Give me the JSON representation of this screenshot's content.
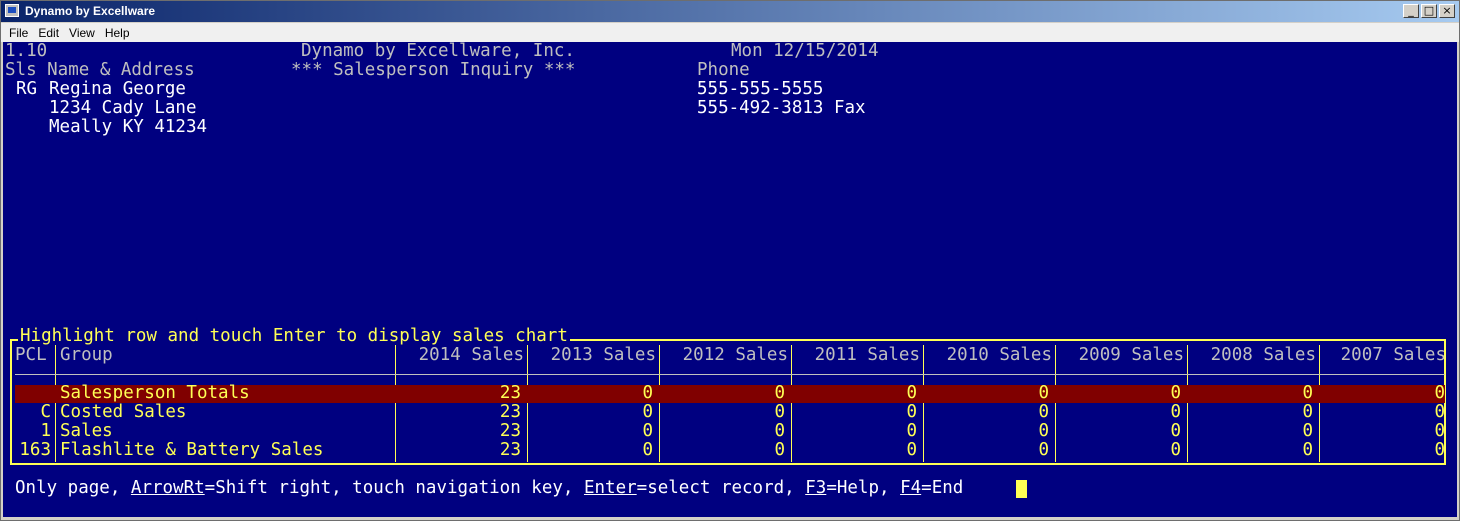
{
  "window": {
    "title": "Dynamo by Excellware",
    "btn_min": "_",
    "btn_max": "□",
    "btn_close": "×"
  },
  "menu": [
    "File",
    "Edit",
    "View",
    "Help"
  ],
  "header": {
    "version": "1.10",
    "company": "Dynamo by Excellware, Inc.",
    "date": "Mon 12/15/2014",
    "col_left": "Sls Name & Address",
    "screen_title": "*** Salesperson Inquiry ***",
    "col_phone": "Phone"
  },
  "salesperson": {
    "code": "RG",
    "name": "Regina George",
    "address1": "1234 Cady Lane",
    "address2": "Meally KY 41234",
    "phone": "555-555-5555",
    "fax": "555-492-3813 Fax"
  },
  "table": {
    "title": "Highlight row and touch Enter to display sales chart",
    "columns": [
      "PCL",
      "Group",
      "2014 Sales",
      "2013 Sales",
      "2012 Sales",
      "2011 Sales",
      "2010 Sales",
      "2009 Sales",
      "2008 Sales",
      "2007 Sales"
    ],
    "rows": [
      {
        "pcl": "",
        "group": "Salesperson Totals",
        "values": [
          "23",
          "0",
          "0",
          "0",
          "0",
          "0",
          "0",
          "0"
        ]
      },
      {
        "pcl": "C",
        "group": "Costed Sales",
        "values": [
          "23",
          "0",
          "0",
          "0",
          "0",
          "0",
          "0",
          "0"
        ]
      },
      {
        "pcl": "1",
        "group": "Sales",
        "values": [
          "23",
          "0",
          "0",
          "0",
          "0",
          "0",
          "0",
          "0"
        ]
      },
      {
        "pcl": "163",
        "group": "Flashlite & Battery Sales",
        "values": [
          "23",
          "0",
          "0",
          "0",
          "0",
          "0",
          "0",
          "0"
        ]
      }
    ]
  },
  "footer": {
    "text1": "Only page, ",
    "key1": "ArrowRt",
    "text2": "=Shift right, touch navigation key, ",
    "key2": "Enter",
    "text3": "=select record, ",
    "key3": "F3",
    "text4": "=Help, ",
    "key4": "F4",
    "text5": "=End"
  }
}
